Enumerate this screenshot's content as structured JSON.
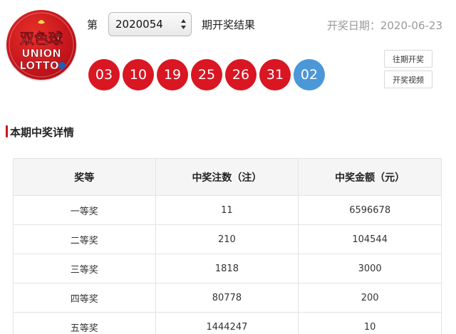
{
  "logo": {
    "text_cn": "双色球",
    "text_union": "UNION",
    "text_lotto": "LOTTO",
    "brand_color": "#c3141b"
  },
  "header": {
    "issue_prefix": "第",
    "issue_value": "2020054",
    "result_suffix": "期开奖结果",
    "date_label": "开奖日期：2020-06-23"
  },
  "balls": {
    "red": [
      "03",
      "10",
      "19",
      "25",
      "26",
      "31"
    ],
    "blue": [
      "02"
    ],
    "red_color": "#d91622",
    "blue_color": "#4b97d8"
  },
  "side_buttons": {
    "history_label": "往期开奖",
    "video_label": "开奖视频"
  },
  "section": {
    "title": "本期中奖详情"
  },
  "table": {
    "headers": [
      "奖等",
      "中奖注数（注）",
      "中奖金额（元）"
    ],
    "rows": [
      [
        "一等奖",
        "11",
        "6596678"
      ],
      [
        "二等奖",
        "210",
        "104544"
      ],
      [
        "三等奖",
        "1818",
        "3000"
      ],
      [
        "四等奖",
        "80778",
        "200"
      ],
      [
        "五等奖",
        "1444247",
        "10"
      ]
    ]
  }
}
